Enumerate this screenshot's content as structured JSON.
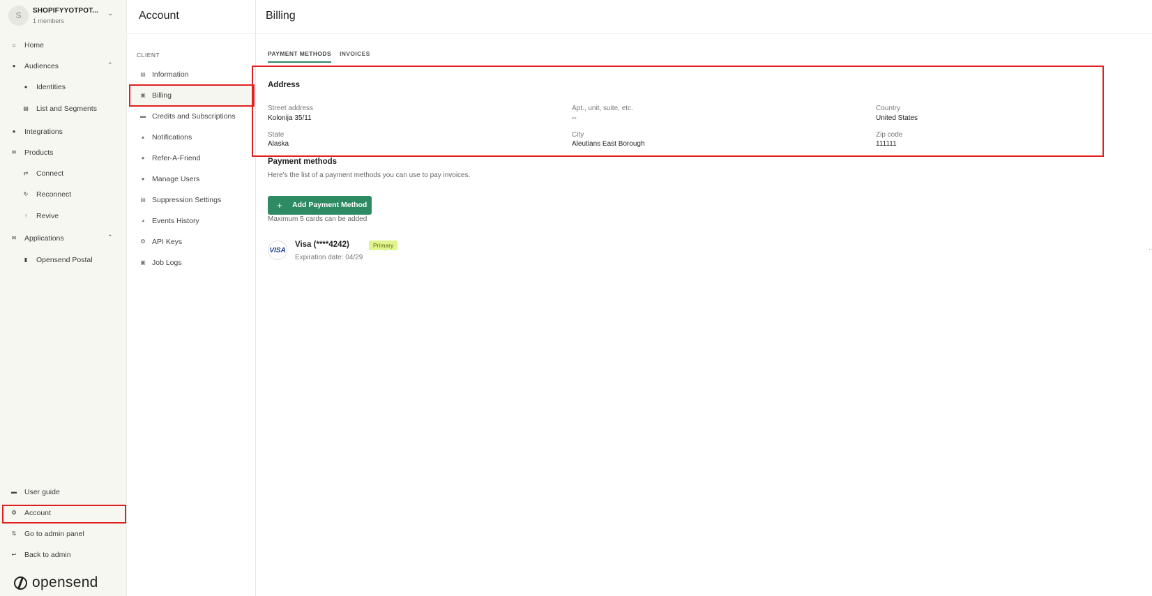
{
  "workspace": {
    "avatar_letter": "S",
    "name": "SHOPIFYYOTPOT...",
    "members": "1 members"
  },
  "sidebar": {
    "items": [
      {
        "label": "Home",
        "icon": "home-icon"
      },
      {
        "label": "Audiences",
        "icon": "person-icon"
      },
      {
        "label": "Identities",
        "icon": "person-icon"
      },
      {
        "label": "List and Segments",
        "icon": "list-icon"
      },
      {
        "label": "Integrations",
        "icon": "plug-icon"
      },
      {
        "label": "Products",
        "icon": "mail-icon"
      },
      {
        "label": "Connect",
        "icon": "connect-icon"
      },
      {
        "label": "Reconnect",
        "icon": "reconnect-icon"
      },
      {
        "label": "Revive",
        "icon": "revive-icon"
      },
      {
        "label": "Applications",
        "icon": "mail-icon"
      },
      {
        "label": "Opensend Postal",
        "icon": "postal-icon"
      }
    ],
    "bottom_items": [
      {
        "label": "User guide",
        "icon": "folder-icon"
      },
      {
        "label": "Account",
        "icon": "gear-icon"
      },
      {
        "label": "Go to admin panel",
        "icon": "swap-icon"
      },
      {
        "label": "Back to admin",
        "icon": "back-arrow-icon"
      }
    ],
    "logo_text": "opensend"
  },
  "account_menu": {
    "title": "Account",
    "section": "CLIENT",
    "items": [
      {
        "label": "Information",
        "icon": "info-icon"
      },
      {
        "label": "Billing",
        "icon": "bank-icon"
      },
      {
        "label": "Credits and Subscriptions",
        "icon": "card-icon"
      },
      {
        "label": "Notifications",
        "icon": "bell-icon"
      },
      {
        "label": "Refer-A-Friend",
        "icon": "person-icon"
      },
      {
        "label": "Manage Users",
        "icon": "users-icon"
      },
      {
        "label": "Suppression Settings",
        "icon": "list-icon"
      },
      {
        "label": "Events History",
        "icon": "clock-icon"
      },
      {
        "label": "API Keys",
        "icon": "key-icon"
      },
      {
        "label": "Job Logs",
        "icon": "log-icon"
      }
    ]
  },
  "main": {
    "title": "Billing",
    "tabs": [
      {
        "label": "PAYMENT METHODS"
      },
      {
        "label": "INVOICES"
      }
    ],
    "address": {
      "title": "Address",
      "fields": [
        {
          "label": "Street address",
          "value": "Kolonija 35/11"
        },
        {
          "label": "Apt., unit, suite, etc.",
          "value": "--"
        },
        {
          "label": "Country",
          "value": "United States"
        },
        {
          "label": "State",
          "value": "Alaska"
        },
        {
          "label": "City",
          "value": "Aleutians East Borough"
        },
        {
          "label": "Zip code",
          "value": "111111"
        }
      ]
    },
    "payment": {
      "title": "Payment methods",
      "description": "Here's the list of a payment methods you can use to pay invoices.",
      "add_button": "Add Payment Method",
      "note": "Maximum 5 cards can be added",
      "card": {
        "brand": "VISA",
        "title": "Visa (****4242)",
        "badge": "Primary",
        "expiration": "Expiration date: 04/29"
      }
    }
  },
  "colors": {
    "accent": "#2d8a63",
    "highlight": "#e02020",
    "badge_bg": "#dff58d"
  }
}
